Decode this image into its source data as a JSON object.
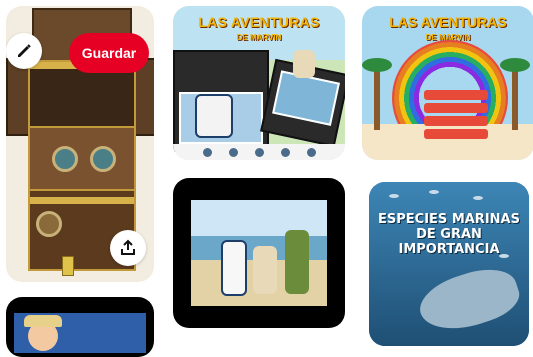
{
  "actions": {
    "save_label": "Guardar",
    "edit_icon": "pencil-icon",
    "share_icon": "share-upload-icon"
  },
  "pins": [
    {
      "title_line1": "LAS AVENTURAS",
      "title_line2": "DE MARVIN"
    },
    {
      "title_line1": "LAS AVENTURAS",
      "title_line2": "DE MARVIN"
    },
    {
      "title": "ESPECIES MARINAS DE GRAN IMPORTANCIA"
    }
  ],
  "colors": {
    "save_button": "#e60023",
    "title_yellow": "#f2b400"
  }
}
